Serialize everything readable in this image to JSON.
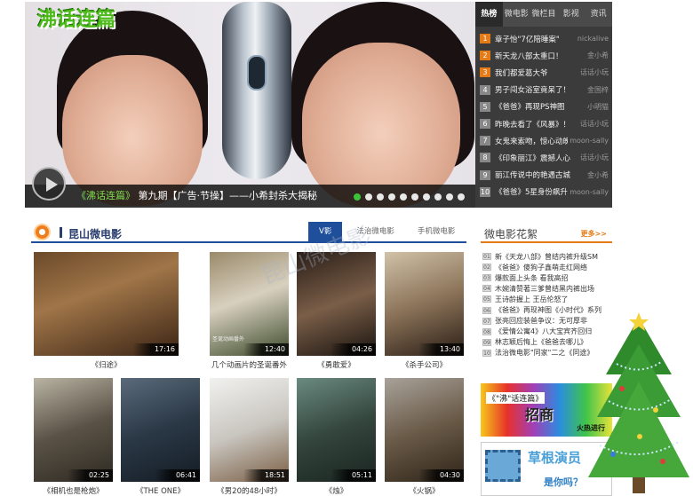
{
  "hero": {
    "logo_text": "沸话连篇",
    "caption_highlight": "《沸话连篇》",
    "caption_rest": "第九期【广告·节操】——小希封杀大揭秘",
    "slide_count": 10,
    "active_slide": 1
  },
  "hot": {
    "tabs": [
      "热榜",
      "微电影",
      "微栏目",
      "影视",
      "资讯"
    ],
    "items": [
      {
        "num": "1",
        "title": "章子怡\"7亿陪睡案\"",
        "user": "nickalive"
      },
      {
        "num": "2",
        "title": "新天龙八部太重口！",
        "user": "金小希"
      },
      {
        "num": "3",
        "title": "我们都爱葛大爷",
        "user": "话话小玩"
      },
      {
        "num": "4",
        "title": "男子闯女浴室竟呆了！",
        "user": "金国梓"
      },
      {
        "num": "5",
        "title": "《爸爸》再现PS神图",
        "user": "小明猫"
      },
      {
        "num": "6",
        "title": "昨晚去看了《风暴》！",
        "user": "话话小玩"
      },
      {
        "num": "7",
        "title": "女鬼来索吻，惊心动魄",
        "user": "moon-sally"
      },
      {
        "num": "8",
        "title": "《印象丽江》震撼人心",
        "user": "话话小玩"
      },
      {
        "num": "9",
        "title": "丽江传说中的艳遇古城",
        "user": "金小希"
      },
      {
        "num": "10",
        "title": "《爸爸》5星身份飙升",
        "user": "moon-sally"
      }
    ]
  },
  "section": {
    "title": "昆山微电影",
    "tabs": [
      "V影",
      "法治微电影",
      "手机微电影"
    ],
    "active_tab": 0
  },
  "videos": [
    {
      "caption": "《归途》",
      "duration": "17:16"
    },
    {
      "caption": "几个动画片的圣诞番外",
      "duration": "12:40",
      "subtext": "圣诞动画番外"
    },
    {
      "caption": "《勇敢爱》",
      "duration": "04:26"
    },
    {
      "caption": "《杀手公司》",
      "duration": "13:40"
    },
    {
      "caption": "《相机也是枪炮》",
      "duration": "02:25"
    },
    {
      "caption": "《THE ONE》",
      "duration": "06:41"
    },
    {
      "caption": "《男20的48小时》",
      "duration": "18:51"
    },
    {
      "caption": "《烛》",
      "duration": "05:11"
    },
    {
      "caption": "《火锅》",
      "duration": "04:30"
    }
  ],
  "side": {
    "title": "微电影花絮",
    "more": "更多>>",
    "items": [
      {
        "num": "01",
        "title": "新《天龙八部》曾结内裤升级SM"
      },
      {
        "num": "02",
        "title": "《爸爸》傻狗子鑫萌走红网络"
      },
      {
        "num": "03",
        "title": "爆款面上头条 看我高招"
      },
      {
        "num": "04",
        "title": "木婉清赞著三爹曾结黑内裤出场"
      },
      {
        "num": "05",
        "title": "王诗龄握上 王岳伦怒了"
      },
      {
        "num": "06",
        "title": "《爸爸》再现神图《小时代》系列"
      },
      {
        "num": "07",
        "title": "张亮回应装爸争议：无可厚非"
      },
      {
        "num": "08",
        "title": "《爱情公寓4》八大宝宾齐回归"
      },
      {
        "num": "09",
        "title": "林志颖后悔上《爸爸去哪儿》"
      },
      {
        "num": "10",
        "title": "法治微电影\"同家\"二之《同途》"
      }
    ],
    "ad1": {
      "a": "《\"沸\"话连篇》",
      "b": "招商",
      "c": "火热进行"
    },
    "ad2": {
      "a": "草根演员",
      "b": "是你吗？"
    }
  },
  "colors": {
    "accent_orange": "#e57b16",
    "nav_blue": "#1f4f9a",
    "hot_bg": "#3b3b3b"
  },
  "watermark": "昆山微电影"
}
